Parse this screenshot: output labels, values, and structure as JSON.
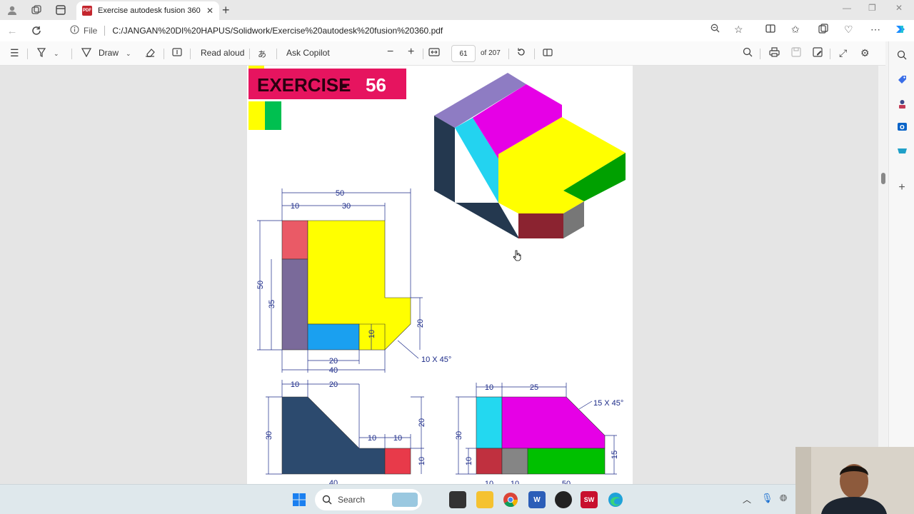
{
  "browser": {
    "tab_title": "Exercise autodesk fusion 360.pdf",
    "file_label": "File",
    "url": "C:/JANGAN%20DI%20HAPUS/Solidwork/Exercise%20autodesk%20fusion%20360.pdf"
  },
  "pdf_toolbar": {
    "draw_label": "Draw",
    "read_aloud_label": "Read aloud",
    "ask_copilot_label": "Ask Copilot",
    "current_page": "61",
    "page_total": "of 207",
    "zoom_out": "−",
    "zoom_in": "+"
  },
  "document": {
    "title_prefix": "EXERCISE",
    "title_number": "56",
    "front_view": {
      "dims": [
        "50",
        "10",
        "30",
        "50",
        "35",
        "20",
        "10",
        "20",
        "40"
      ],
      "callout": "10 X 45°"
    },
    "top_view": {
      "dims": [
        "10",
        "20",
        "20",
        "10",
        "10",
        "10",
        "30",
        "40"
      ]
    },
    "side_view": {
      "dims": [
        "10",
        "25",
        "30",
        "10",
        "15",
        "10",
        "10",
        "50"
      ],
      "callout": "15 X 45°"
    }
  },
  "taskbar": {
    "search_label": "Search"
  },
  "colors": {
    "title_banner": "#e6145f",
    "yellow": "#ffff00",
    "magenta": "#e600e6",
    "purple": "#8e7cc3",
    "navy": "#2c4a6e",
    "cyan": "#23d3f0",
    "green": "#00c000",
    "maroon": "#8b2330",
    "gray": "#808080",
    "salmon": "#e8505b",
    "blue": "#1aa0f0",
    "dim_color": "#1b2a88"
  }
}
